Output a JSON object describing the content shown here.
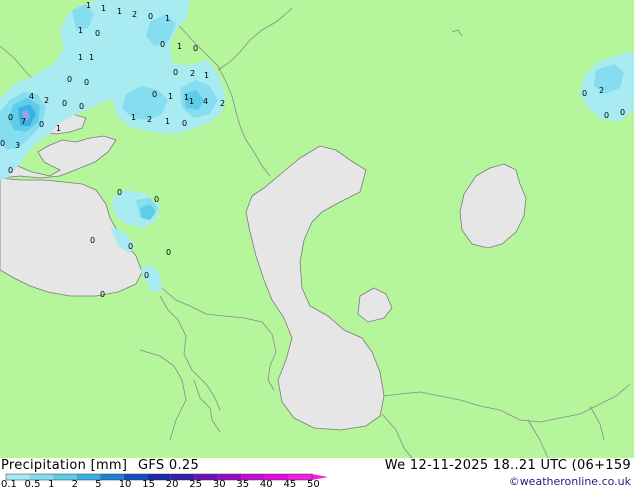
{
  "title": "Precipitation [mm]",
  "model": "GFS 0.25",
  "valid_time": "We 12-11-2025 18..21 UTC (06+159",
  "credit": "©weatheronline.co.uk",
  "legend": {
    "ticks": [
      "0.1",
      "0.5",
      "1",
      "2",
      "5",
      "10",
      "15",
      "20",
      "25",
      "30",
      "35",
      "40",
      "45",
      "50"
    ],
    "colors": [
      "#a8eaf5",
      "#84dcef",
      "#5dcbe8",
      "#3aaee2",
      "#2180d2",
      "#1650c0",
      "#1a2ea8",
      "#3a1ea6",
      "#6a14b4",
      "#9a0cc2",
      "#c20ed0",
      "#e010d8",
      "#f020e0"
    ]
  },
  "colors": {
    "land": "#b5f59c",
    "water": "#e6e6e6",
    "border": "#888888"
  },
  "precip_values": [
    "1",
    "1",
    "1",
    "2",
    "0",
    "1",
    "1",
    "0",
    "0",
    "1",
    "0",
    "1",
    "0",
    "1",
    "1",
    "0",
    "0",
    "0",
    "2",
    "1",
    "4",
    "2",
    "0",
    "0",
    "0",
    "7",
    "0",
    "1",
    "3",
    "0",
    "0",
    "1",
    "1",
    "2",
    "1",
    "0",
    "0",
    "0",
    "0",
    "0",
    "0",
    "0",
    "0",
    "1",
    "4",
    "2",
    "0",
    "2",
    "0",
    "0"
  ]
}
